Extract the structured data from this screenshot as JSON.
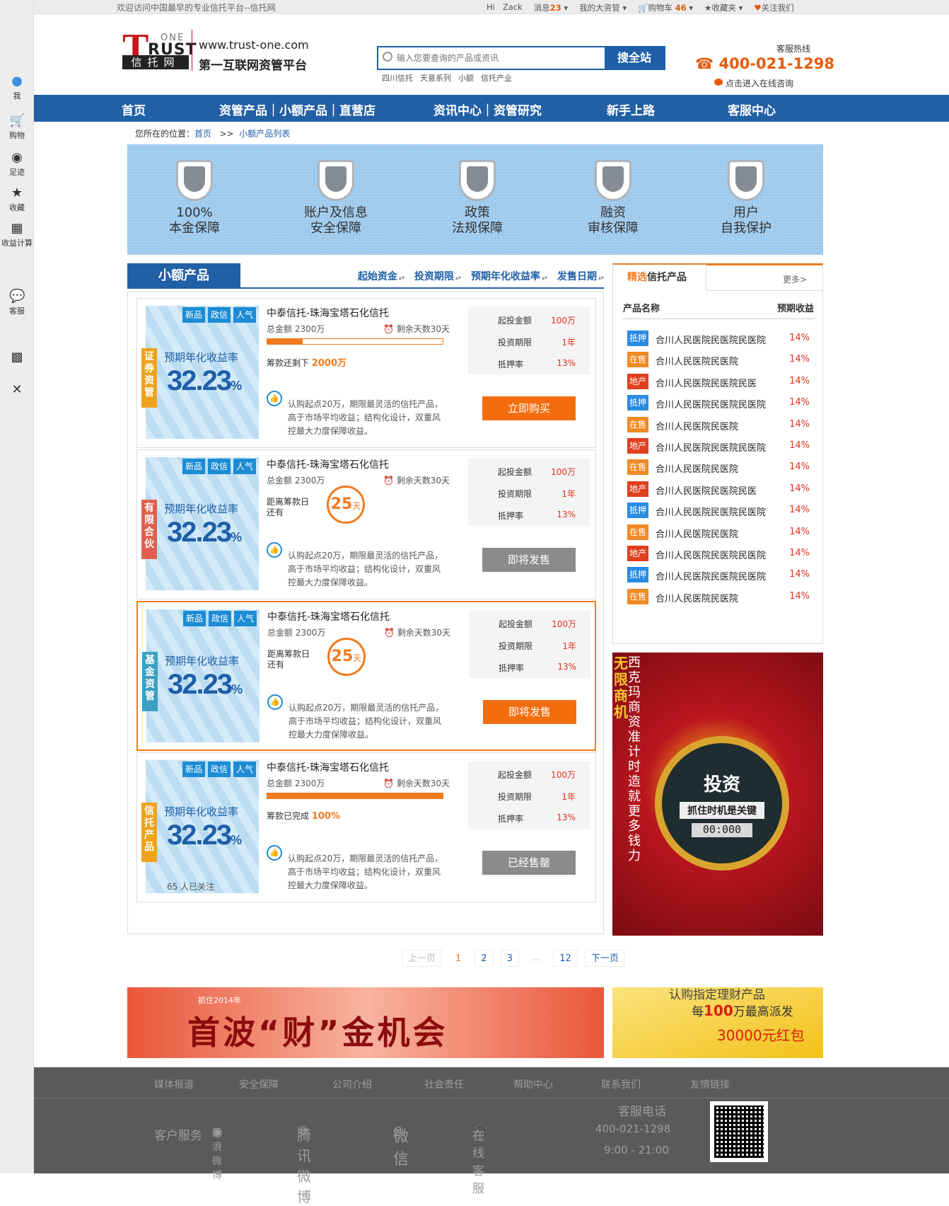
{
  "sidebar": [
    {
      "label": "我",
      "icon": "user-icon"
    },
    {
      "label": "购物",
      "icon": "cart-icon"
    },
    {
      "label": "足迹",
      "icon": "eye-icon"
    },
    {
      "label": "收藏",
      "icon": "star-icon"
    },
    {
      "label": "收益计算",
      "icon": "calculator-icon"
    },
    {
      "label": "客服",
      "icon": "chat-icon"
    },
    {
      "label": "",
      "icon": "qrcode-icon"
    },
    {
      "label": "",
      "icon": "close-icon"
    }
  ],
  "topbar": {
    "welcome": "欢迎访问中国最早的专业信托平台--信托网",
    "hi": "Hi",
    "user": "Zack",
    "messages": "消息",
    "msg_count": "23",
    "assets": "我的大资管",
    "cart": "购物车",
    "cart_count": "46",
    "favorites": "收藏夹",
    "follow": "关注我们"
  },
  "logo": {
    "one": "ONE",
    "rust": "RUST",
    "cn": "信托网",
    "url": "www.trust-one.com",
    "slogan": "第一互联网资管平台"
  },
  "search": {
    "placeholder": "输入您要查询的产品或资讯",
    "button": "搜全站",
    "hot": [
      "四川信托",
      "天意系列",
      "小额",
      "信托产业"
    ]
  },
  "hotline": {
    "label": "客服热线",
    "number": "400-021-1298",
    "online": "点击进入在线咨询"
  },
  "nav": [
    "首页",
    "资管产品｜小额产品｜直营店",
    "资讯中心｜资管研究",
    "新手上路",
    "客服中心"
  ],
  "breadcrumb": {
    "prefix": "您所在的位置：",
    "home": "首页",
    "sep": ">>",
    "current": "小额产品列表"
  },
  "banner": [
    {
      "l1": "100%",
      "l2": "本金保障"
    },
    {
      "l1": "账户及信息",
      "l2": "安全保障"
    },
    {
      "l1": "政策",
      "l2": "法规保障"
    },
    {
      "l1": "融资",
      "l2": "审核保障"
    },
    {
      "l1": "用户",
      "l2": "自我保护"
    }
  ],
  "tab": {
    "current": "小额产品",
    "sorts": [
      "起始资金",
      "投资期限",
      "预期年化收益率",
      "发售日期"
    ]
  },
  "products": [
    {
      "cat": "证券资管",
      "catColor": "#f0a21e",
      "tags": [
        "新品",
        "政信",
        "人气"
      ],
      "yield_label": "预期年化收益率",
      "yield": "32.23",
      "pct": "%",
      "title": "中泰信托-珠海宝塔石化信托",
      "total": "总金额 2300万",
      "days": "剩余天数30天",
      "progress": 0.2,
      "remain_label": "筹款还剩下",
      "remain_val": "2000万",
      "desc": "认购起点20万，期限最灵活的信托产品，高于市场平均收益；结构化设计，双重风控最大力度保障收益。",
      "min_label": "起投金额",
      "min": "100万",
      "term_label": "投资期限",
      "term": "1年",
      "rate_label": "抵押率",
      "rate": "13%",
      "action": "立即购买",
      "btn": "orange",
      "mode": "bar"
    },
    {
      "cat": "有限合伙",
      "catColor": "#e0604e",
      "tags": [
        "新品",
        "政信",
        "人气"
      ],
      "yield_label": "预期年化收益率",
      "yield": "32.23",
      "pct": "%",
      "title": "中泰信托-珠海宝塔石化信托",
      "total": "总金额 2300万",
      "days": "剩余天数30天",
      "count_label": "距离筹款日还有",
      "count": "25",
      "count_unit": "天",
      "desc": "认购起点20万，期限最灵活的信托产品，高于市场平均收益；结构化设计，双重风控最大力度保障收益。",
      "min_label": "起投金额",
      "min": "100万",
      "term_label": "投资期限",
      "term": "1年",
      "rate_label": "抵押率",
      "rate": "13%",
      "action": "即将发售",
      "btn": "grey",
      "mode": "count"
    },
    {
      "cat": "基金资管",
      "catColor": "#3aa0c0",
      "tags": [
        "新品",
        "政信",
        "人气"
      ],
      "yield_label": "预期年化收益率",
      "yield": "32.23",
      "pct": "%",
      "title": "中泰信托-珠海宝塔石化信托",
      "total": "总金额 2300万",
      "days": "剩余天数30天",
      "count_label": "距离筹款日还有",
      "count": "25",
      "count_unit": "天",
      "desc": "认购起点20万，期限最灵活的信托产品，高于市场平均收益；结构化设计，双重风控最大力度保障收益。",
      "min_label": "起投金额",
      "min": "100万",
      "term_label": "投资期限",
      "term": "1年",
      "rate_label": "抵押率",
      "rate": "13%",
      "action": "即将发售",
      "btn": "orange",
      "mode": "count",
      "highlight": true
    },
    {
      "cat": "信托产品",
      "catColor": "#f0a21e",
      "tags": [
        "新品",
        "政信",
        "人气"
      ],
      "yield_label": "预期年化收益率",
      "yield": "32.23",
      "pct": "%",
      "title": "中泰信托-珠海宝塔石化信托",
      "total": "总金额 2300万",
      "days": "剩余天数30天",
      "progress": 1.0,
      "remain_label": "筹款已完成",
      "remain_val": "100%",
      "focus": "65 人已关注",
      "desc": "认购起点20万，期限最灵活的信托产品，高于市场平均收益；结构化设计，双重风控最大力度保障收益。",
      "min_label": "起投金额",
      "min": "100万",
      "term_label": "投资期限",
      "term": "1年",
      "rate_label": "抵押率",
      "rate": "13%",
      "action": "已经售罄",
      "btn": "grey",
      "mode": "bar"
    }
  ],
  "pager": {
    "prev": "上一页",
    "pages": [
      "1",
      "2",
      "3",
      "...",
      "12"
    ],
    "next": "下一页"
  },
  "side": {
    "title_hl": "精选",
    "title": "信托产品",
    "more": "更多>",
    "col1": "产品名称",
    "col2": "预期收益",
    "rows": [
      {
        "tag": "抵押",
        "color": "#2a8be0",
        "name": "合川人民医院民医院民医院",
        "val": "14%"
      },
      {
        "tag": "在售",
        "color": "#f08a24",
        "name": "合川人民医院民医院",
        "val": "14%"
      },
      {
        "tag": "地产",
        "color": "#e0401e",
        "name": "合川人民医院民医院民医",
        "val": "14%"
      },
      {
        "tag": "抵押",
        "color": "#2a8be0",
        "name": "合川人民医院民医院民医院",
        "val": "14%"
      },
      {
        "tag": "在售",
        "color": "#f08a24",
        "name": "合川人民医院民医院",
        "val": "14%"
      },
      {
        "tag": "地产",
        "color": "#e0401e",
        "name": "合川人民医院民医院民医院",
        "val": "14%"
      },
      {
        "tag": "在售",
        "color": "#f08a24",
        "name": "合川人民医院民医院",
        "val": "14%"
      },
      {
        "tag": "地产",
        "color": "#e0401e",
        "name": "合川人民医院民医院民医",
        "val": "14%"
      },
      {
        "tag": "抵押",
        "color": "#2a8be0",
        "name": "合川人民医院民医院民医院",
        "val": "14%"
      },
      {
        "tag": "在售",
        "color": "#f08a24",
        "name": "合川人民医院民医院",
        "val": "14%"
      },
      {
        "tag": "地产",
        "color": "#e0401e",
        "name": "合川人民医院民医院民医院",
        "val": "14%"
      },
      {
        "tag": "抵押",
        "color": "#2a8be0",
        "name": "合川人民医院民医院民医院",
        "val": "14%"
      },
      {
        "tag": "在售",
        "color": "#f08a24",
        "name": "合川人民医院民医院",
        "val": "14%"
      }
    ]
  },
  "ad_side": {
    "v1": "无限商机",
    "v2": "西克玛商资准计时造就更多钱力",
    "w1": "投资",
    "w2": "抓住时机是关键",
    "w3": "00:000"
  },
  "ad_bottom": {
    "small": "抓住2014年",
    "big": "首波“财”金机会"
  },
  "ad_right": {
    "a": "认购指定理财产品",
    "b1": "每",
    "b2": "100",
    "b3": "万最高派发",
    "c": "30000元红包"
  },
  "footer": {
    "links": [
      "媒体报道",
      "安全保障",
      "公司介绍",
      "社会责任",
      "帮助中心",
      "联系我们",
      "友情链接"
    ],
    "service": "客户服务",
    "weibo": "新浪微博",
    "tencent": "腾讯微博",
    "wechat": "微信",
    "online": "在线客服",
    "tel_label": "客服电话",
    "tel": "400-021-1298",
    "hours": "9:00 - 21:00"
  }
}
